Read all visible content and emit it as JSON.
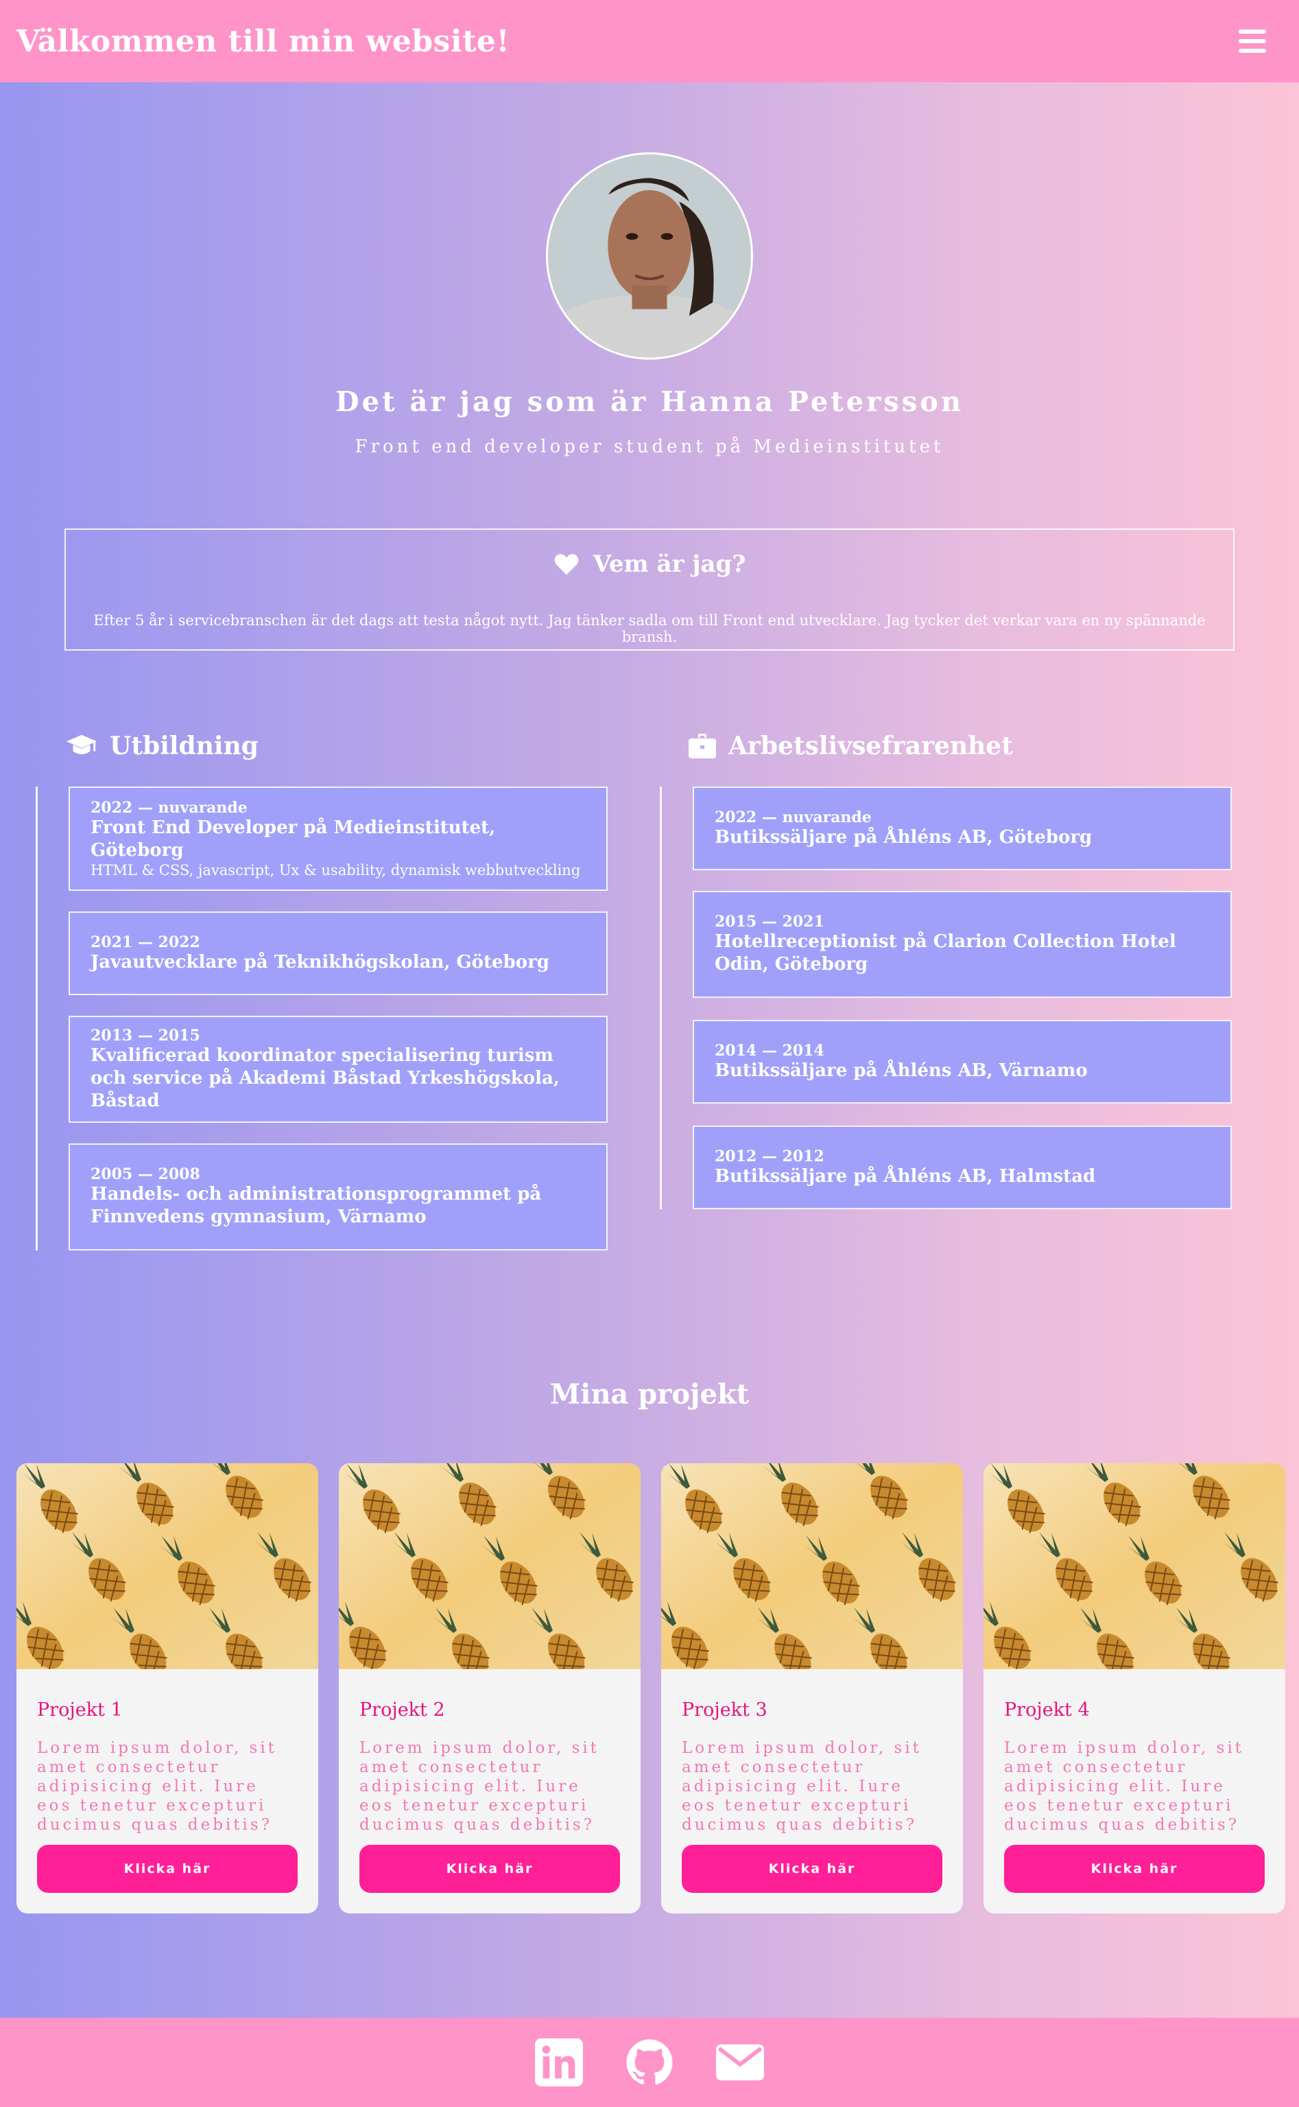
{
  "header": {
    "title": "Välkommen till min website!",
    "menu_icon": "hamburger-icon"
  },
  "profile": {
    "name": "Det är jag som är Hanna Petersson",
    "role": "Front end developer student på Medieinstitutet"
  },
  "about": {
    "icon": "heart-icon",
    "heading": "Vem är jag?",
    "text": "Efter 5 år i servicebranschen är det dags att testa något nytt. Jag tänker sadla om till Front end utvecklare. Jag tycker det verkar vara en ny spännande bransh."
  },
  "education": {
    "icon": "graduation-cap-icon",
    "heading": "Utbildning",
    "items": [
      {
        "date": "2022 — nuvarande",
        "title": "Front End Developer på Medieinstitutet, Göteborg",
        "desc": "HTML & CSS, javascript, Ux & usability, dynamisk webbutveckling"
      },
      {
        "date": "2021 — 2022",
        "title": "Javautvecklare på Teknikhögskolan, Göteborg",
        "desc": ""
      },
      {
        "date": "2013 — 2015",
        "title": "Kvalificerad koordinator specialisering turism och service på Akademi Båstad Yrkeshögskola, Båstad",
        "desc": ""
      },
      {
        "date": "2005 — 2008",
        "title": "Handels- och administrationsprogrammet på Finnvedens gymnasium, Värnamo",
        "desc": ""
      }
    ]
  },
  "work": {
    "icon": "briefcase-icon",
    "heading": "Arbetslivsefrarenhet",
    "items": [
      {
        "date": "2022 — nuvarande",
        "title": "Butikssäljare på Åhléns AB, Göteborg"
      },
      {
        "date": "2015 — 2021",
        "title": "Hotellreceptionist på Clarion Collection Hotel Odin, Göteborg"
      },
      {
        "date": "2014 — 2014",
        "title": "Butikssäljare på Åhléns AB, Värnamo"
      },
      {
        "date": "2012 — 2012",
        "title": "Butikssäljare på Åhléns AB, Halmstad"
      }
    ]
  },
  "projects": {
    "heading": "Mina projekt",
    "items": [
      {
        "title": "Projekt 1",
        "text": "Lorem ipsum dolor, sit amet consectetur adipisicing elit. Iure eos tenetur excepturi ducimus quas debitis?",
        "button": "Klicka här"
      },
      {
        "title": "Projekt 2",
        "text": "Lorem ipsum dolor, sit amet consectetur adipisicing elit. Iure eos tenetur excepturi ducimus quas debitis?",
        "button": "Klicka här"
      },
      {
        "title": "Projekt 3",
        "text": "Lorem ipsum dolor, sit amet consectetur adipisicing elit. Iure eos tenetur excepturi ducimus quas debitis?",
        "button": "Klicka här"
      },
      {
        "title": "Projekt 4",
        "text": "Lorem ipsum dolor, sit amet consectetur adipisicing elit. Iure eos tenetur excepturi ducimus quas debitis?",
        "button": "Klicka här"
      }
    ]
  },
  "footer": {
    "icons": [
      "linkedin-icon",
      "github-icon",
      "envelope-icon"
    ]
  },
  "colors": {
    "header": "#ff94c8",
    "entry": "#a0a0fb",
    "button": "#ff1f96",
    "card_title": "#e5137f"
  }
}
